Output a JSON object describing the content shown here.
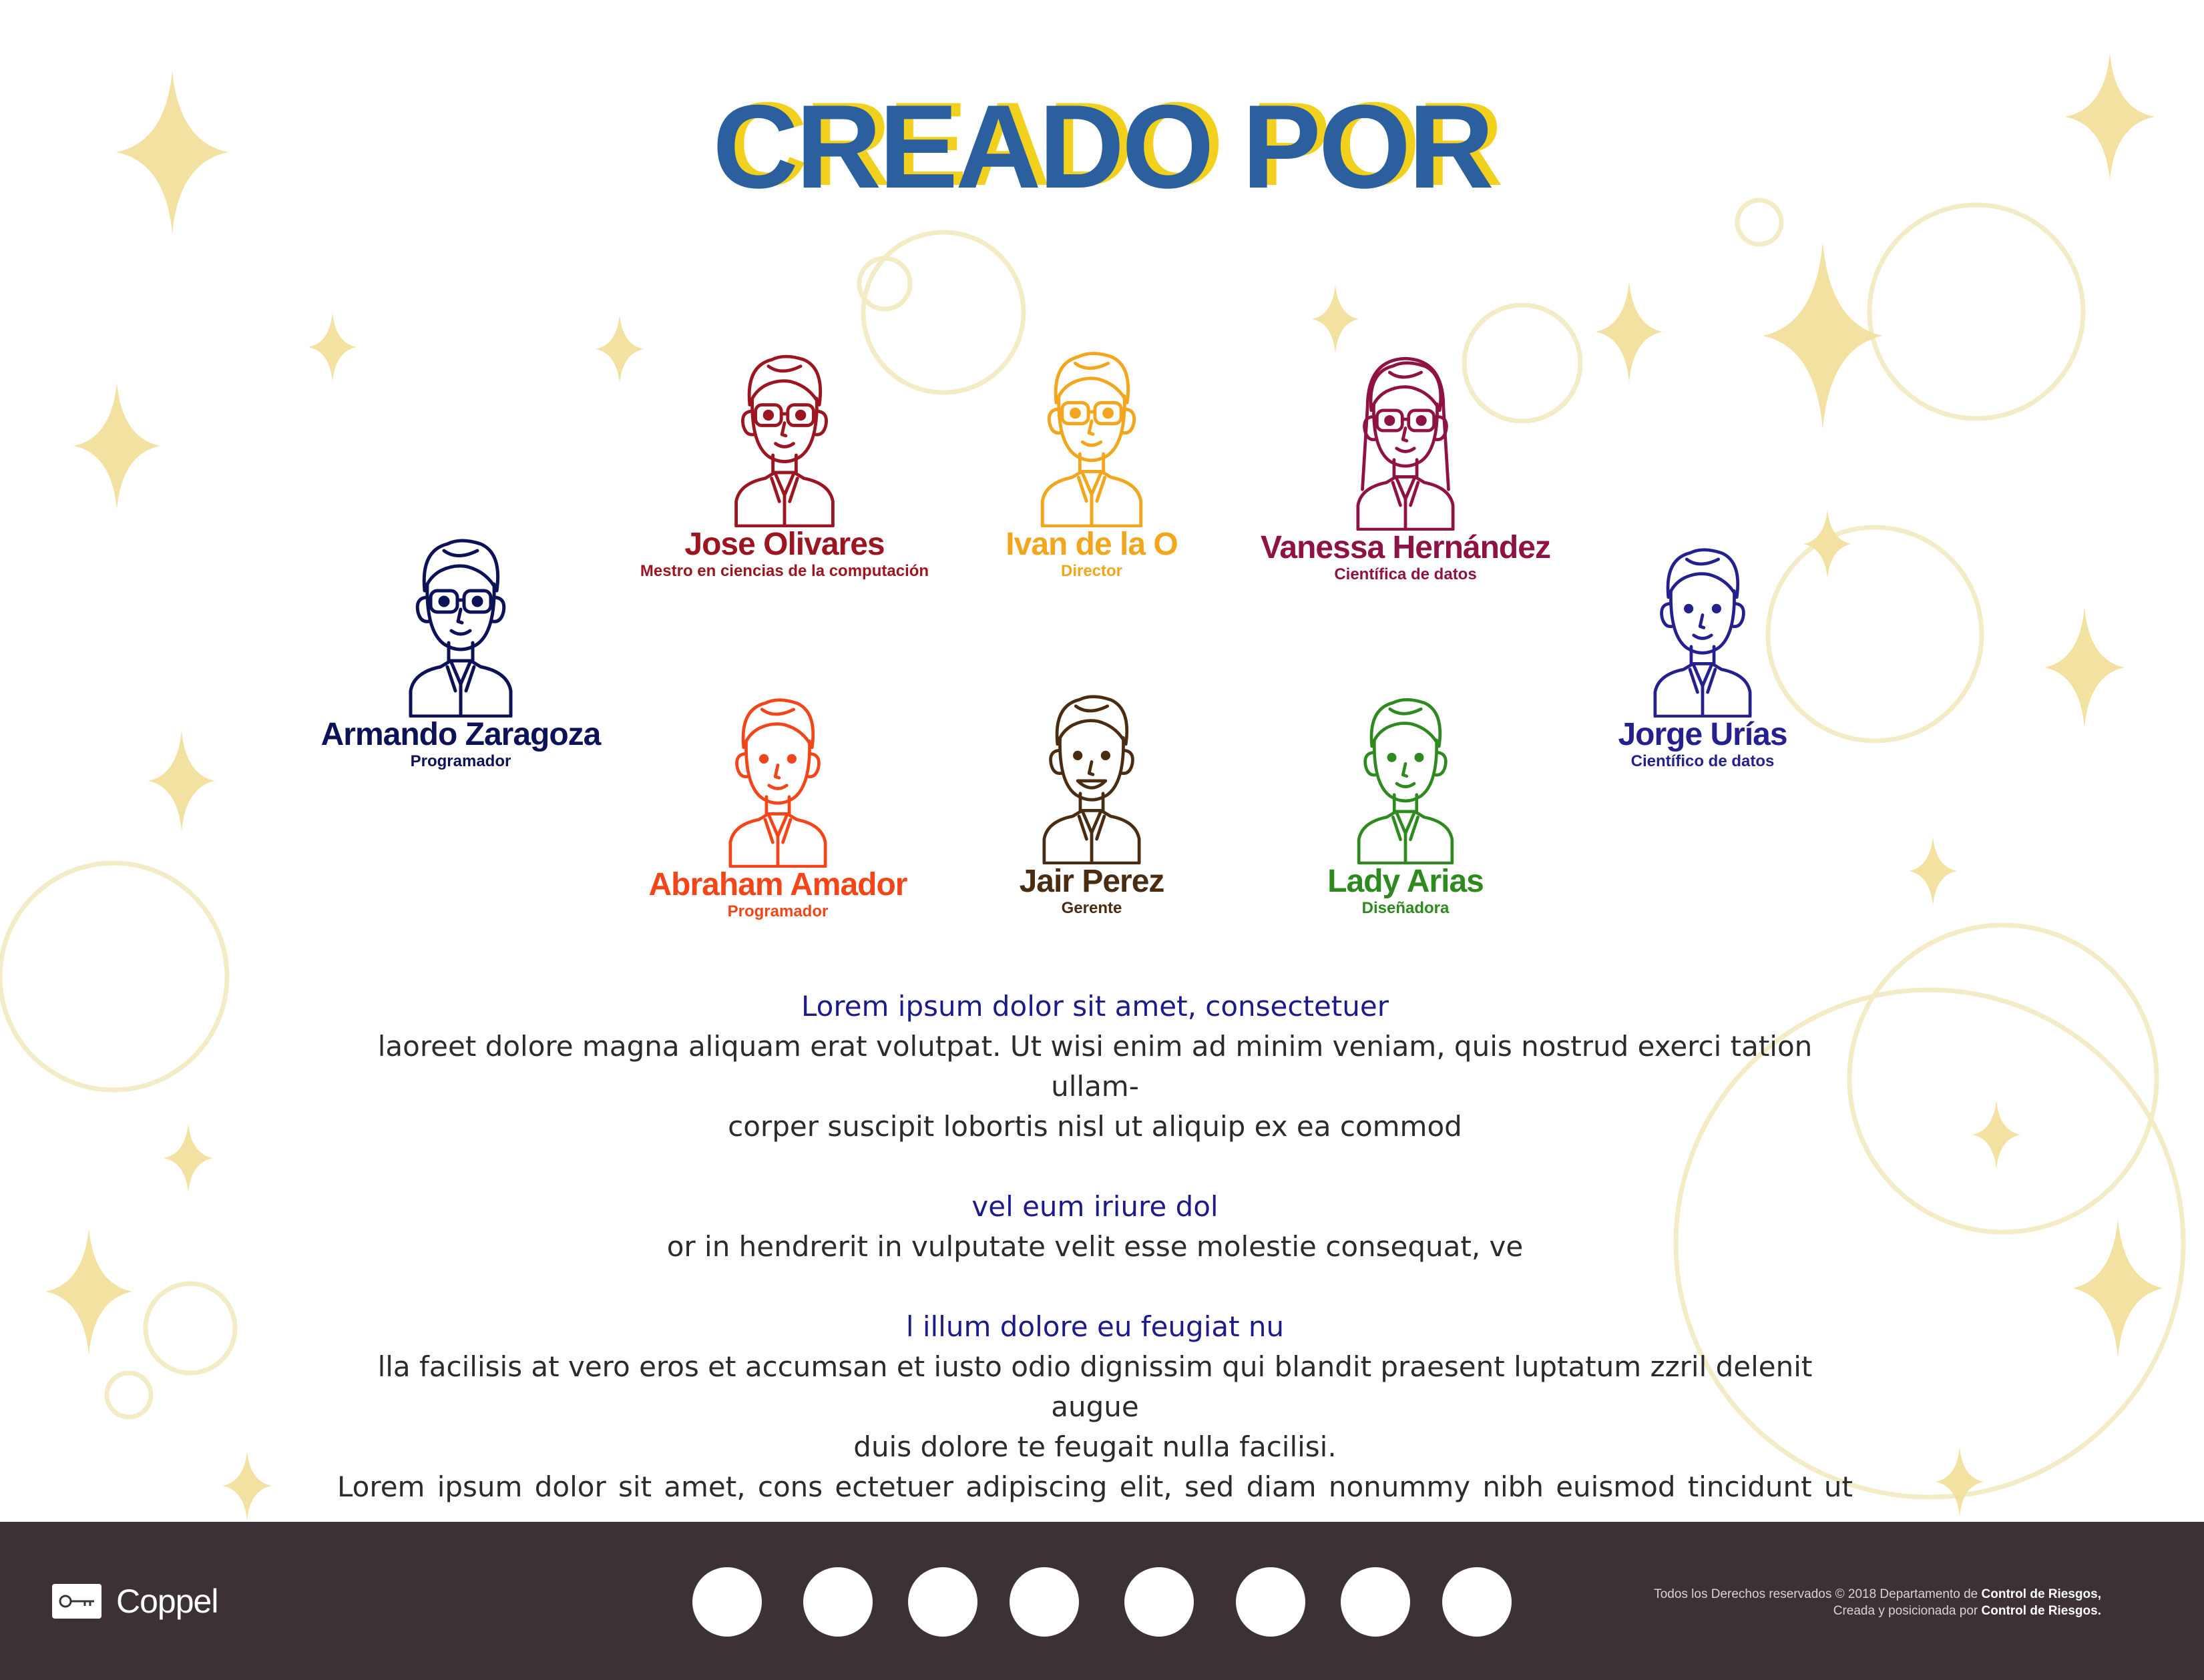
{
  "title": "CREADO POR",
  "colors": {
    "title": "#2b5f9e",
    "title_shadow": "#f2d11e",
    "sparkle": "#f2e1a0",
    "circle": "#f3ecc6",
    "heading": "#1d1a8a",
    "body_text": "#2b2b2b",
    "footer_bg": "#3c3137"
  },
  "team": [
    {
      "name": "Armando Zaragoza",
      "role": "Programador",
      "color": "#0d1257"
    },
    {
      "name": "Jose Olivares",
      "role": "Mestro en ciencias de la computación",
      "color": "#9b1620"
    },
    {
      "name": "Ivan de la O",
      "role": "Director",
      "color": "#f2a61e"
    },
    {
      "name": "Vanessa Hernández",
      "role": "Científica de datos",
      "color": "#8e1244"
    },
    {
      "name": "Jorge Urías",
      "role": "Científico de datos",
      "color": "#24208e"
    },
    {
      "name": "Abraham Amador",
      "role": "Programador",
      "color": "#f2461a"
    },
    {
      "name": "Jair Perez",
      "role": "Gerente",
      "color": "#4a2c12"
    },
    {
      "name": "Lady Arias",
      "role": "Diseñadora",
      "color": "#2e8a1f"
    }
  ],
  "content": {
    "heading1": "Lorem ipsum dolor sit amet, consectetuer",
    "para1_line1": "laoreet dolore magna aliquam erat volutpat. Ut wisi enim ad minim veniam, quis nostrud exerci tation ullam-",
    "para1_line2": "corper suscipit lobortis nisl ut aliquip ex ea commod",
    "heading2": "vel eum iriure dol",
    "para2": "or in hendrerit in vulputate velit esse molestie consequat, ve",
    "heading3": "l illum dolore eu feugiat nu",
    "para3_line1": "lla facilisis at vero eros et accumsan et iusto odio dignissim qui blandit praesent luptatum zzril delenit augue",
    "para3_line2": "duis dolore te feugait nulla facilisi.",
    "para3_line3": "Lorem ipsum dolor sit amet, cons ectetuer adipiscing elit, sed diam nonummy nibh euismod tincidunt ut"
  },
  "footer": {
    "brand": "Coppel",
    "brand_icon": "key-icon",
    "nav_dots": 8,
    "copyright_prefix": "Todos los Derechos reservados © 2018 Departamento de ",
    "copyright_bold1": "Control de Riesgos,",
    "copyright_line2_prefix": "Creada y posicionada por ",
    "copyright_bold2": "Control  de Riesgos."
  }
}
